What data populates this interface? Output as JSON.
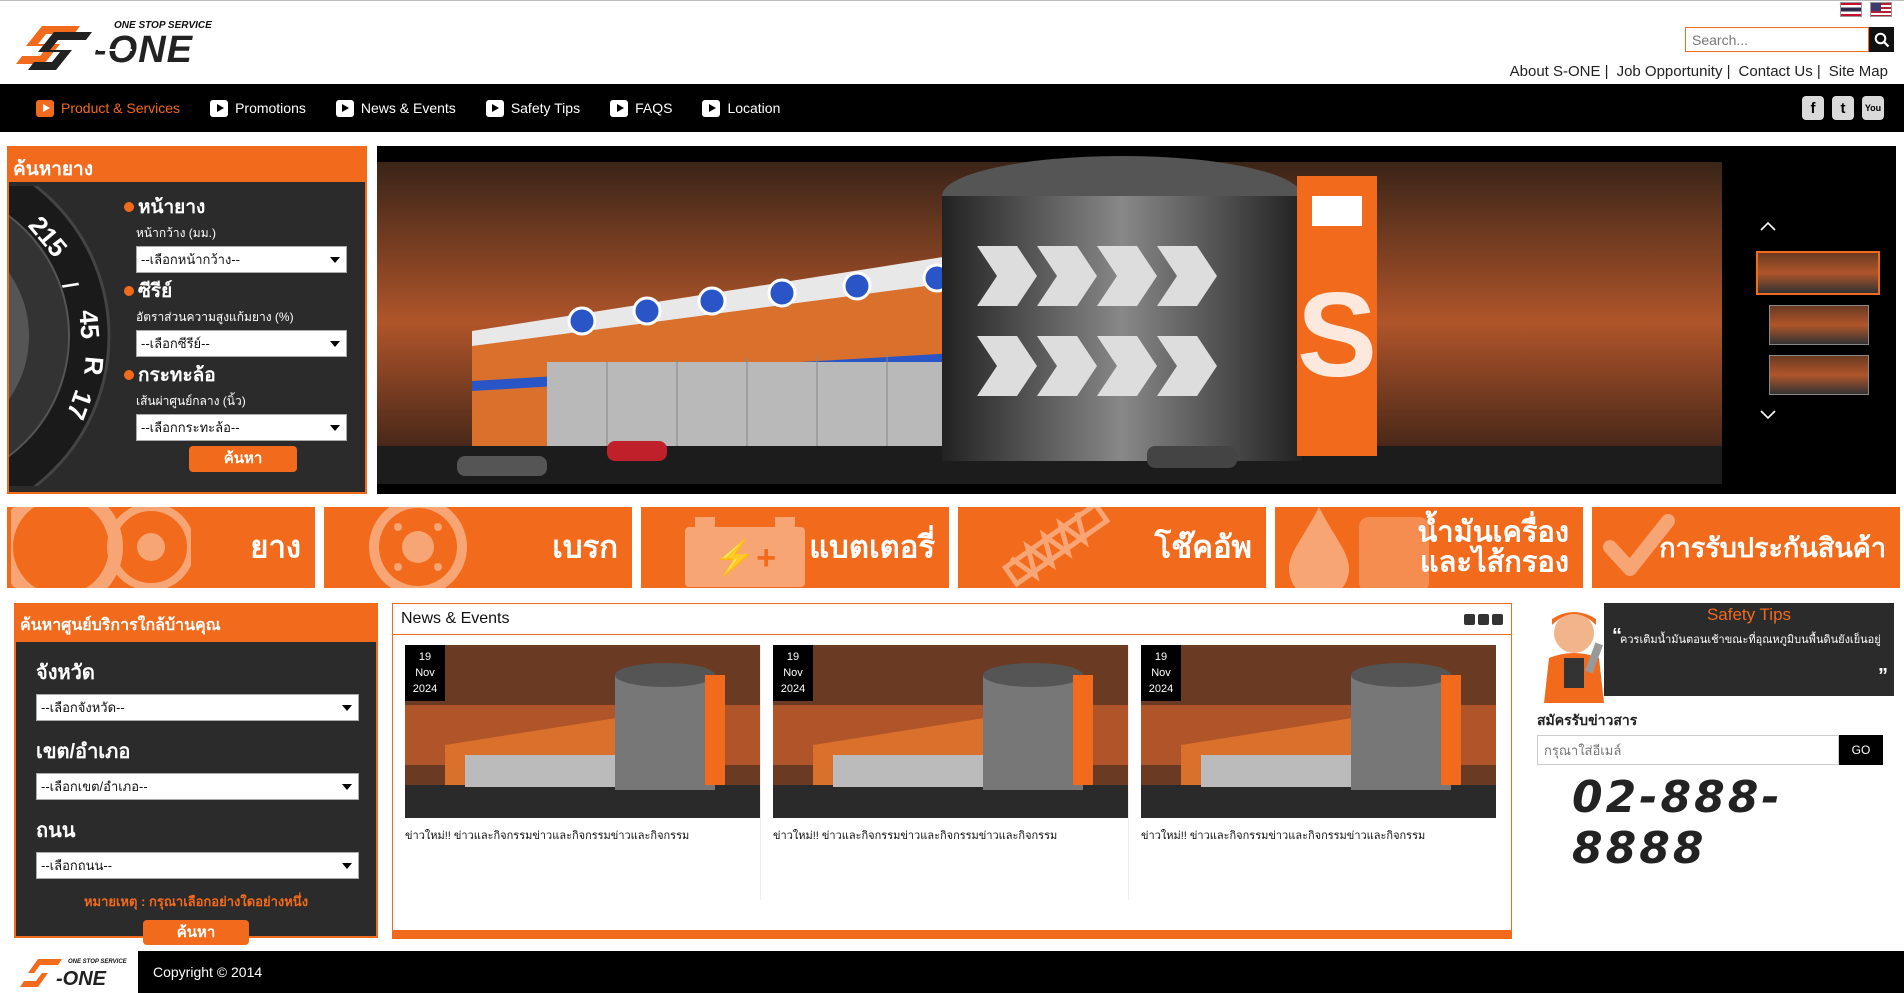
{
  "brand": {
    "tagline": "ONE STOP SERVICE",
    "name": "S-ONE"
  },
  "header": {
    "search_placeholder": "Search...",
    "links": [
      "About S-ONE |",
      "Job Opportunity |",
      "Contact Us |",
      "Site Map"
    ]
  },
  "nav": {
    "items": [
      {
        "label": "Product & Services",
        "active": true
      },
      {
        "label": "Promotions",
        "active": false
      },
      {
        "label": "News & Events",
        "active": false
      },
      {
        "label": "Safety Tips",
        "active": false
      },
      {
        "label": "FAQS",
        "active": false
      },
      {
        "label": "Location",
        "active": false
      }
    ],
    "social": [
      "facebook-icon",
      "twitter-icon",
      "youtube-icon"
    ]
  },
  "tire_search": {
    "title": "ค้นหายาง",
    "tire_text": [
      "215",
      "/",
      "45",
      "R",
      "17"
    ],
    "width": {
      "title": "หน้ายาง",
      "sub": "หน้ากว้าง (มม.)",
      "value": "--เลือกหน้ากว้าง--"
    },
    "series": {
      "title": "ซีรีย์",
      "sub": "อัตราส่วนความสูงแก้มยาง (%)",
      "value": "--เลือกซีรีย์--"
    },
    "rim": {
      "title": "กระทะล้อ",
      "sub": "เส้นผ่าศูนย์กลาง (นิ้ว)",
      "value": "--เลือกกระทะล้อ--"
    },
    "button": "ค้นหา"
  },
  "categories": [
    {
      "label": "ยาง",
      "icon": "tire-icon"
    },
    {
      "label": "เบรก",
      "icon": "brake-disc-icon"
    },
    {
      "label": "แบตเตอรี่",
      "icon": "battery-icon"
    },
    {
      "label": "โช๊คอัพ",
      "icon": "shock-absorber-icon"
    },
    {
      "label_line1": "น้ำมันเครื่อง",
      "label_line2": "และไส้กรอง",
      "icon": "oil-drop-icon"
    },
    {
      "label": "การรับประกันสินค้า",
      "icon": "checkmark-icon"
    }
  ],
  "service_search": {
    "title": "ค้นหาศูนย์บริการใกล้บ้านคุณ",
    "province": {
      "label": "จังหวัด",
      "value": "--เลือกจังหวัด--"
    },
    "district": {
      "label": "เขต/อำเภอ",
      "value": "--เลือกเขต/อำเภอ--"
    },
    "road": {
      "label": "ถนน",
      "value": "--เลือกถนน--"
    },
    "note": "หมายเหตุ : กรุณาเลือกอย่างใดอย่างหนึ่ง",
    "button": "ค้นหา"
  },
  "news": {
    "title": "News & Events",
    "items": [
      {
        "day": "19",
        "month": "Nov",
        "year": "2024",
        "title": "ข่าวใหม่!! ข่าวและกิจกรรมข่าวและกิจกรรมข่าวและกิจกรรม"
      },
      {
        "day": "19",
        "month": "Nov",
        "year": "2024",
        "title": "ข่าวใหม่!! ข่าวและกิจกรรมข่าวและกิจกรรมข่าวและกิจกรรม"
      },
      {
        "day": "19",
        "month": "Nov",
        "year": "2024",
        "title": "ข่าวใหม่!! ข่าวและกิจกรรมข่าวและกิจกรรมข่าวและกิจกรรม"
      }
    ]
  },
  "safety": {
    "title": "Safety Tips",
    "text": "ควรเติมน้ำมันตอนเช้าขณะที่อุณหภูมิบนพื้นดินยังเย็นอยู่"
  },
  "newsletter": {
    "label": "สมัครรับข่าวสาร",
    "placeholder": "กรุณาใส่อีเมล์",
    "button": "GO"
  },
  "phone": "02-888-8888",
  "footer": {
    "copyright": "Copyright © 2014"
  },
  "colors": {
    "accent": "#f26a1b",
    "dark": "#2b2b2b",
    "nav": "#000000"
  }
}
